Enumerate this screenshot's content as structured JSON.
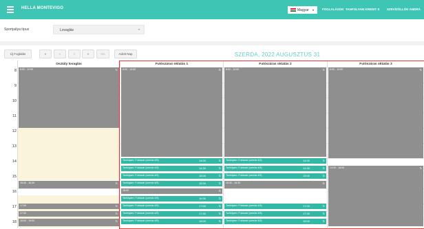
{
  "header": {
    "brand": "HELLA MONTEVIGO",
    "language": "Magyar",
    "nav": [
      "FOGLALÁSOK",
      "TANFOLYAM KREDIT S",
      "SZEVÍZÖLLÖK ANDRÁ"
    ],
    "bg_color": "#3fc5b4"
  },
  "filter": {
    "label": "Sportpálya típus",
    "value": "Lovaglás"
  },
  "toolbar": {
    "booking": "Új Foglalás",
    "first": "«",
    "prev": "‹",
    "next": "›",
    "last": "»",
    "refresh": "Ma",
    "today": "Adott Nap",
    "date_title": "SZERDA, 2022 AUGUSZTUS 31"
  },
  "time_labels": [
    "8",
    "9",
    "10",
    "11",
    "12",
    "13",
    "14",
    "15",
    "16",
    "17",
    "18"
  ],
  "columns": [
    {
      "title": "Osztály lovaglás"
    },
    {
      "title": "Futószáras oktatás 1"
    },
    {
      "title": "Futószáras oktatás 2"
    },
    {
      "title": "Futószáras oktatás 3"
    }
  ],
  "colors": {
    "busy": "#8f8f8f",
    "booking": "#33b8a5",
    "free": "#faf4dd",
    "accent": "#5fd0c3",
    "highlight": "#ee3535"
  },
  "events": {
    "col1": [
      {
        "time": "8:00 - 12:00"
      },
      {
        "time": "15:30 - 16:30"
      },
      {
        "time": "17:00"
      },
      {
        "time": "17:30"
      },
      {
        "time": "18:00 - 19:00"
      }
    ],
    "col2": [
      {
        "time": "8:00 - 14:00"
      },
      {
        "time": "14:00",
        "label": "Tanfolyam: Futószár (szerda 4/5)"
      },
      {
        "time": "14:30",
        "label": "Tanfolyam: Futószár (szerda 4/5)"
      },
      {
        "time": "15:00",
        "label": "Tanfolyam: Futószár (szerda 4/5)"
      },
      {
        "time": "15:30",
        "label": "Tanfolyam: Futószár (szerda 4/5)"
      },
      {
        "time": "16:00"
      },
      {
        "time": "16:30",
        "label": "Tanfolyam: Futószár (szerda 4/5)"
      },
      {
        "time": "17:00",
        "label": "Tanfolyam: Futószár (szerda 4/5)"
      },
      {
        "time": "17:30",
        "label": "Tanfolyam: Futószár (szerda 4/5)"
      },
      {
        "time": "18:00",
        "label": "Tanfolyam: Futószár (szerda 4/5)"
      }
    ],
    "col3": [
      {
        "time": "8:00 - 14:00"
      },
      {
        "time": "14:00",
        "label": "Tanfolyam: Futószár (szerda 4/5)"
      },
      {
        "time": "14:30",
        "label": "Tanfolyam: Futószár (szerda 4/5)"
      },
      {
        "time": "15:00",
        "label": "Tanfolyam: Futószár (szerda 4/5)"
      },
      {
        "time": "15:30 - 16:30"
      },
      {
        "time": "17:00",
        "label": "Tanfolyam: Futószár (szerda 4/5)"
      },
      {
        "time": "17:30",
        "label": "Tanfolyam: Futószár (szerda 4/5)"
      },
      {
        "time": "18:00",
        "label": "Tanfolyam: Futószár (szerda 4/5)"
      }
    ],
    "col4": [
      {
        "time": "8:00 - 14:00"
      },
      {
        "time": "14:30 - 18:00"
      }
    ]
  }
}
